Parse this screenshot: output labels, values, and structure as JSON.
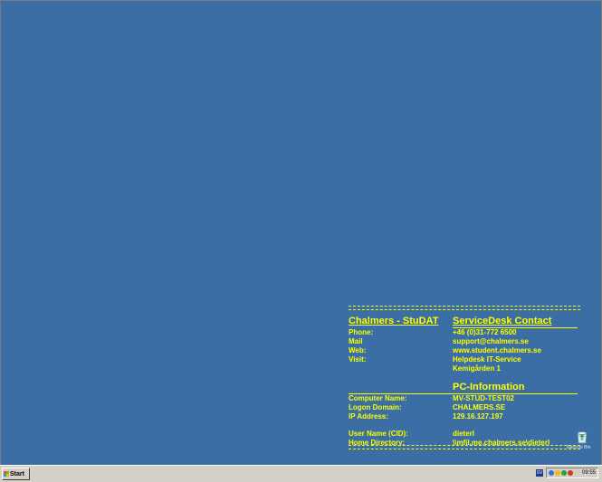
{
  "info": {
    "left_title": "Chalmers - StuDAT",
    "right_title": "ServiceDesk Contact",
    "contact": [
      {
        "key": "Phone:",
        "value": "+46 (0)31-772 6500"
      },
      {
        "key": "Mail",
        "value": "support@chalmers.se"
      },
      {
        "key": "Web:",
        "value": "www.student.chalmers.se"
      },
      {
        "key": "Visit:",
        "value": "Helpdesk IT-Service"
      },
      {
        "key": "",
        "value": "Kemigården 1"
      }
    ],
    "pc_title": "PC-Information",
    "pc": [
      {
        "key": "Computer Name:",
        "value": "MV-STUD-TEST02"
      },
      {
        "key": "Logon Domain:",
        "value": "CHALMERS.SE"
      },
      {
        "key": "IP Address:",
        "value": "129.16.127.197"
      }
    ],
    "user": [
      {
        "key": "User Name (CID):",
        "value": "dieterl"
      },
      {
        "key": "Home Directory:",
        "value": "\\\\mfil.me.chalmers.se\\dieterl"
      }
    ]
  },
  "desktop": {
    "recycle_label": "Recycle Bin"
  },
  "taskbar": {
    "start_label": "Start",
    "lang": "SV",
    "clock": "09:55",
    "colors": {
      "tray1": "#3b6fd0",
      "tray2": "#e8c000",
      "tray3": "#2fa02f",
      "tray4": "#c04020"
    }
  }
}
